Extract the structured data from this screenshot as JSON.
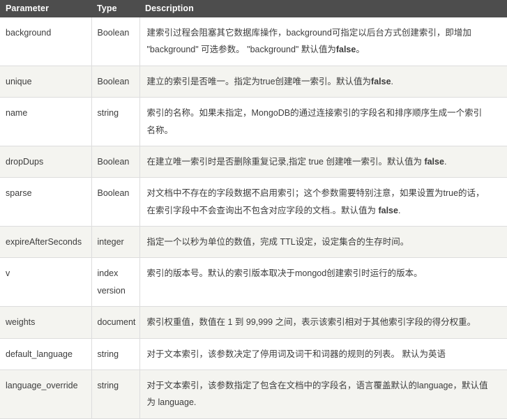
{
  "table": {
    "headers": {
      "parameter": "Parameter",
      "type": "Type",
      "description": "Description"
    },
    "rows": [
      {
        "parameter": "background",
        "type": "Boolean",
        "description_line1": "建索引过程会阻塞其它数据库操作，background可指定以后台方式创建索引，即增加",
        "description_line2_a": "\"background\" 可选参数。 \"background\" 默认值为",
        "description_line2_bold": "false",
        "description_line2_b": "。"
      },
      {
        "parameter": "unique",
        "type": "Boolean",
        "description_line1": "建立的索引是否唯一。指定为true创建唯一索引。默认值为",
        "description_line1_bold": "false",
        "description_line1_b": "."
      },
      {
        "parameter": "name",
        "type": "string",
        "description_line1": "索引的名称。如果未指定，MongoDB的通过连接索引的字段名和排序顺序生成一个索引",
        "description_line2": "名称。"
      },
      {
        "parameter": "dropDups",
        "type": "Boolean",
        "description_line1": "在建立唯一索引时是否删除重复记录,指定 true 创建唯一索引。默认值为 ",
        "description_line1_bold": "false",
        "description_line1_b": "."
      },
      {
        "parameter": "sparse",
        "type": "Boolean",
        "description_line1": "对文档中不存在的字段数据不启用索引；这个参数需要特别注意，如果设置为true的话，",
        "description_line2_a": "在索引字段中不会查询出不包含对应字段的文档.。默认值为 ",
        "description_line2_bold": "false",
        "description_line2_b": "."
      },
      {
        "parameter": "expireAfterSeconds",
        "type": "integer",
        "description_line1": "指定一个以秒为单位的数值，完成 TTL设定，设定集合的生存时间。"
      },
      {
        "parameter": "v",
        "type_line1": "index",
        "type_line2": "version",
        "description_line1": "索引的版本号。默认的索引版本取决于mongod创建索引时运行的版本。"
      },
      {
        "parameter": "weights",
        "type": "document",
        "description_line1": "索引权重值，数值在 1 到 99,999 之间，表示该索引相对于其他索引字段的得分权重。"
      },
      {
        "parameter": "default_language",
        "type": "string",
        "description_line1": "对于文本索引，该参数决定了停用词及词干和词器的规则的列表。 默认为英语"
      },
      {
        "parameter": "language_override",
        "type": "string",
        "description_line1": "对于文本索引，该参数指定了包含在文档中的字段名，语言覆盖默认的language，默认值",
        "description_line2": "为 language."
      }
    ]
  },
  "colors": {
    "header_bg": "#4d4d4d",
    "header_text": "#ffffff",
    "row_alt_bg": "#f4f4f0",
    "row_bg": "#ffffff",
    "border": "#dddddd",
    "text": "#3c3c3c"
  }
}
